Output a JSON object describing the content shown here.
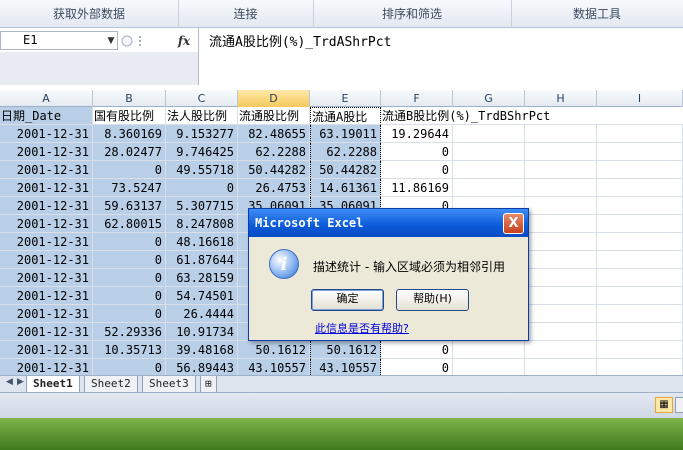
{
  "ribbon": {
    "groups": [
      "获取外部数据",
      "连接",
      "排序和筛选",
      "数据工具"
    ]
  },
  "formula_bar": {
    "name_box": "E1",
    "fx_label": "fx",
    "formula": "流通A股比例(%)_TrdAShrPct"
  },
  "grid": {
    "columns": [
      "A",
      "B",
      "C",
      "D",
      "E",
      "F",
      "G",
      "H",
      "I"
    ],
    "header_row": [
      "日期_Date",
      "国有股比例",
      "法人股比例",
      "流通股比例",
      "流通A股比",
      "流通B股比例(%)_TrdBShrPct",
      "",
      "",
      ""
    ],
    "rows": [
      [
        "2001-12-31",
        "8.360169",
        "9.153277",
        "82.48655",
        "63.19011",
        "19.29644"
      ],
      [
        "2001-12-31",
        "28.02477",
        "9.746425",
        "62.2288",
        "62.2288",
        "0"
      ],
      [
        "2001-12-31",
        "0",
        "49.55718",
        "50.44282",
        "50.44282",
        "0"
      ],
      [
        "2001-12-31",
        "73.5247",
        "0",
        "26.4753",
        "14.61361",
        "11.86169"
      ],
      [
        "2001-12-31",
        "59.63137",
        "5.307715",
        "35.06091",
        "35.06091",
        "0"
      ],
      [
        "2001-12-31",
        "62.80015",
        "8.247808",
        "",
        "",
        ""
      ],
      [
        "2001-12-31",
        "0",
        "48.16618",
        "",
        "",
        ""
      ],
      [
        "2001-12-31",
        "0",
        "61.87644",
        "",
        "",
        ""
      ],
      [
        "2001-12-31",
        "0",
        "63.28159",
        "",
        "",
        ""
      ],
      [
        "2001-12-31",
        "0",
        "54.74501",
        "",
        "",
        ""
      ],
      [
        "2001-12-31",
        "0",
        "26.4444",
        "",
        "",
        ""
      ],
      [
        "2001-12-31",
        "52.29336",
        "10.91734",
        "",
        "",
        ""
      ],
      [
        "2001-12-31",
        "10.35713",
        "39.48168",
        "50.1612",
        "50.1612",
        "0"
      ],
      [
        "2001-12-31",
        "0",
        "56.89443",
        "43.10557",
        "43.10557",
        "0"
      ]
    ]
  },
  "sheet_tabs": [
    "Sheet1",
    "Sheet2",
    "Sheet3"
  ],
  "dialog": {
    "title": "Microsoft Excel",
    "close_label": "X",
    "icon_label": "i",
    "message": "描述统计 - 输入区域必须为相邻引用",
    "ok_label": "确定",
    "help_label": "帮助(H)",
    "link_text": "此信息是否有帮助?"
  },
  "colors": {
    "selection": "#b9cfe8",
    "active_column": "#f6c95b",
    "dialog_title": "#0b5ad8"
  }
}
